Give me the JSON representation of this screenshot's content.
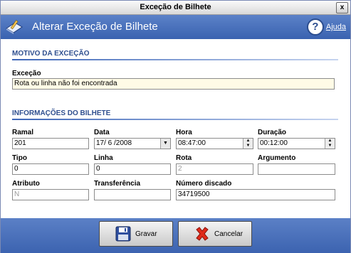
{
  "window": {
    "title": "Exceção de Bilhete",
    "close_glyph": "x"
  },
  "header": {
    "title": "Alterar Exceção de Bilhete",
    "help_label": "Ajuda",
    "help_glyph": "?"
  },
  "sections": {
    "motivo": {
      "title": "MOTIVO DA EXCEÇÃO"
    },
    "info": {
      "title": "INFORMAÇÕES DO BILHETE"
    }
  },
  "fields": {
    "excecao": {
      "label": "Exceção",
      "value": "Rota ou linha não foi encontrada"
    },
    "ramal": {
      "label": "Ramal",
      "value": "201"
    },
    "data": {
      "label": "Data",
      "value": "17/ 6 /2008"
    },
    "hora": {
      "label": "Hora",
      "value": "08:47:00"
    },
    "duracao": {
      "label": "Duração",
      "value": "00:12:00"
    },
    "tipo": {
      "label": "Tipo",
      "value": "0"
    },
    "linha": {
      "label": "Linha",
      "value": "0"
    },
    "rota": {
      "label": "Rota",
      "value": "2"
    },
    "argumento": {
      "label": "Argumento",
      "value": ""
    },
    "atributo": {
      "label": "Atributo",
      "value": "N"
    },
    "transferencia": {
      "label": "Transferência",
      "value": ""
    },
    "numero_discado": {
      "label": "Número discado",
      "value": "34719500"
    }
  },
  "buttons": {
    "save": "Gravar",
    "cancel": "Cancelar"
  },
  "icons": {
    "header": "edit-document-icon",
    "help": "help-icon",
    "save": "floppy-disk-icon",
    "cancel": "red-x-icon"
  },
  "colors": {
    "header_blue": "#4a71bd",
    "section_blue": "#2f4f8f"
  }
}
